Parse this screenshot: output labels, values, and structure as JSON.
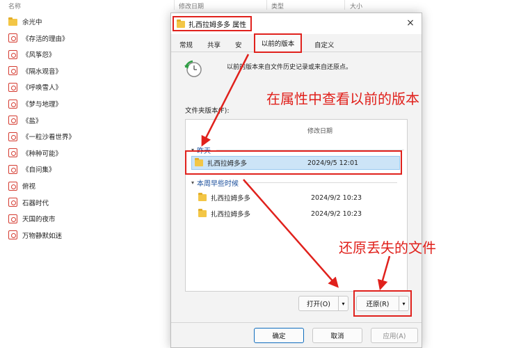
{
  "explorer": {
    "columns": {
      "name": "名称",
      "modified": "修改日期",
      "type": "类型",
      "size": "大小"
    },
    "items": [
      {
        "name": "余光中",
        "kind": "folder"
      },
      {
        "name": "《存活的理由》",
        "kind": "doc"
      },
      {
        "name": "《风筝怨》",
        "kind": "doc"
      },
      {
        "name": "《隔水观音》",
        "kind": "doc"
      },
      {
        "name": "《呼唤雪人》",
        "kind": "doc"
      },
      {
        "name": "《梦与地理》",
        "kind": "doc"
      },
      {
        "name": "《盐》",
        "kind": "doc"
      },
      {
        "name": "《一粒沙看世界》",
        "kind": "doc"
      },
      {
        "name": "《种种可能》",
        "kind": "doc"
      },
      {
        "name": "《自问集》",
        "kind": "doc"
      },
      {
        "name": "俯视",
        "kind": "doc"
      },
      {
        "name": "石器时代",
        "kind": "doc"
      },
      {
        "name": "天国的夜市",
        "kind": "doc"
      },
      {
        "name": "万物静默如迷",
        "kind": "doc"
      }
    ]
  },
  "dialog": {
    "title": "扎西拉姆多多 属性",
    "close_glyph": "×",
    "tabs": {
      "general": "常规",
      "sharing": "共享",
      "security": "安",
      "previous_versions": "以前的版本",
      "customize": "自定义"
    },
    "intro": "以前的版本来自文件历史记录或来自还原点。",
    "versions_label": "文件夹版本(F):",
    "list": {
      "col_modified": "修改日期",
      "groups": [
        {
          "label": "昨天",
          "rows": [
            {
              "name": "扎西拉姆多多",
              "date": "2024/9/5 12:01",
              "selected": true
            }
          ]
        },
        {
          "label": "本周早些时候",
          "rows": [
            {
              "name": "扎西拉姆多多",
              "date": "2024/9/2 10:23",
              "selected": false
            },
            {
              "name": "扎西拉姆多多",
              "date": "2024/9/2 10:23",
              "selected": false
            }
          ]
        }
      ]
    },
    "buttons": {
      "open": "打开(O)",
      "restore": "还原(R)",
      "ok": "确定",
      "cancel": "取消",
      "apply": "应用(A)"
    },
    "dropdown_glyph": "▾"
  },
  "annotations": {
    "view_previous": "在属性中查看以前的版本",
    "restore_lost": "还原丢失的文件"
  },
  "colors": {
    "annotation_red": "#e0211c",
    "selection_blue": "#cce4f7",
    "group_blue": "#1b4f9c",
    "folder_yellow": "#f3c646"
  }
}
